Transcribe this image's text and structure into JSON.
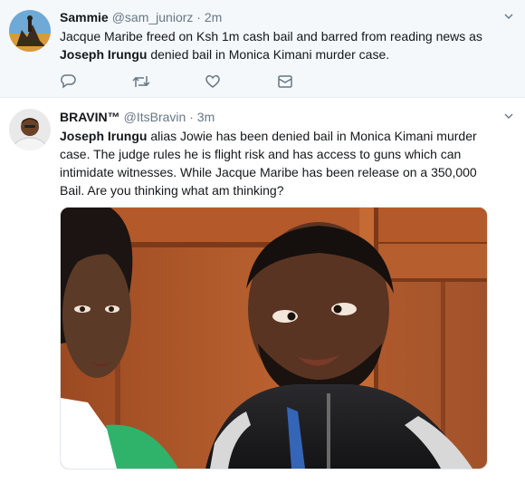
{
  "tweets": [
    {
      "name": "Sammie",
      "handle": "@sam_juniorz",
      "separator": "·",
      "time": "2m",
      "text_part1": "Jacque Maribe freed on Ksh 1m cash bail and barred from reading news as ",
      "text_bold": "Joseph Irungu",
      "text_part2": " denied bail in Monica Kimani murder case.",
      "actions": [
        "reply-icon",
        "retweet-icon",
        "like-icon",
        "message-icon"
      ]
    },
    {
      "name": "BRAVIN™",
      "handle": "@ItsBravin",
      "separator": "·",
      "time": "3m",
      "text_bold": "Joseph Irungu",
      "text_part2": " alias Jowie has been denied bail in Monica Kimani murder case. The judge rules he is flight risk and has access to guns which can intimidate witnesses. While Jacque Maribe has been release on a 350,000 Bail. Are you thinking what am thinking?",
      "media": "photo"
    }
  ],
  "colors": {
    "text": "#14171a",
    "muted": "#657786",
    "highlight_bg": "#f5f8fa",
    "divider": "#e6ecf0"
  }
}
